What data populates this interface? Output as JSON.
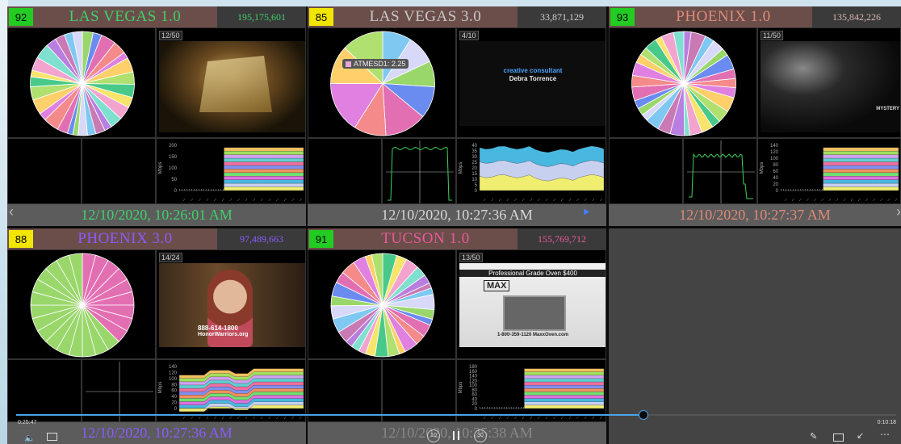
{
  "panels": [
    {
      "score": "92",
      "score_color": "#22cc22",
      "name": "LAS VEGAS 1.0",
      "name_color": "#3fd06a",
      "count": "195,175,601",
      "count_color": "#3fd06a",
      "badge": "12/50",
      "timestamp": "12/10/2020, 10:26:01 AM",
      "ts_color": "#3fd06a"
    },
    {
      "score": "85",
      "score_color": "#f2e600",
      "name": "LAS VEGAS 3.0",
      "name_color": "#c8c8c8",
      "count": "33,871,129",
      "count_color": "#d0d0d0",
      "badge": "4/10",
      "timestamp": "12/10/2020, 10:27:36 AM",
      "ts_color": "#d8d8d8",
      "tooltip": "ATMESD1: 2.25",
      "video_line1": "creative consultant",
      "video_line2": "Debra Torrence"
    },
    {
      "score": "93",
      "score_color": "#22cc22",
      "name": "PHOENIX 1.0",
      "name_color": "#e08a78",
      "count": "135,842,226",
      "count_color": "#d8b8b0",
      "badge": "11/50",
      "timestamp": "12/10/2020, 10:27:37 AM",
      "ts_color": "#e08a78",
      "video_text": "MYSTERY"
    },
    {
      "score": "88",
      "score_color": "#f2e600",
      "name": "PHOENIX 3.0",
      "name_color": "#8a5cff",
      "count": "97,489,663",
      "count_color": "#8a5cff",
      "badge": "14/24",
      "timestamp": "12/10/2020, 10:27:36 AM",
      "ts_color": "#8a5cff",
      "video_line1": "888-614-1800",
      "video_line2": "HonorWarriors.org"
    },
    {
      "score": "91",
      "score_color": "#22cc22",
      "name": "TUCSON 1.0",
      "name_color": "#e85a9a",
      "count": "155,769,712",
      "count_color": "#e85a9a",
      "badge": "13/50",
      "timestamp": "12/10/2020, 10:25:38 AM",
      "ts_color": "#888888",
      "video_line1": "Professional Grade Oven $400",
      "video_line2": "MAX",
      "video_line3": "1-800-359-1120   MaxxOven.com"
    }
  ],
  "yaxis_label": "Mbps",
  "player": {
    "elapsed": "0:25:47",
    "remaining": "0:10:18",
    "skip_back": "10",
    "skip_fwd": "30"
  }
}
